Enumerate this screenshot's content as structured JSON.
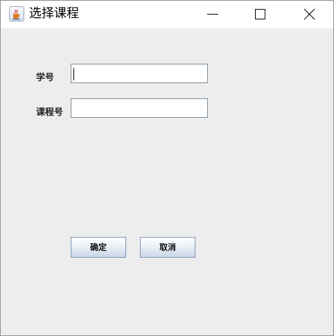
{
  "window": {
    "title": "选择课程",
    "icon": "java-cup-icon",
    "controls": [
      "minimize-icon",
      "maximize-icon",
      "close-icon"
    ]
  },
  "form": {
    "student_id_label": "学号",
    "student_id_value": "",
    "course_id_label": "课程号",
    "course_id_value": ""
  },
  "buttons": {
    "confirm": "确定",
    "cancel": "取消"
  }
}
